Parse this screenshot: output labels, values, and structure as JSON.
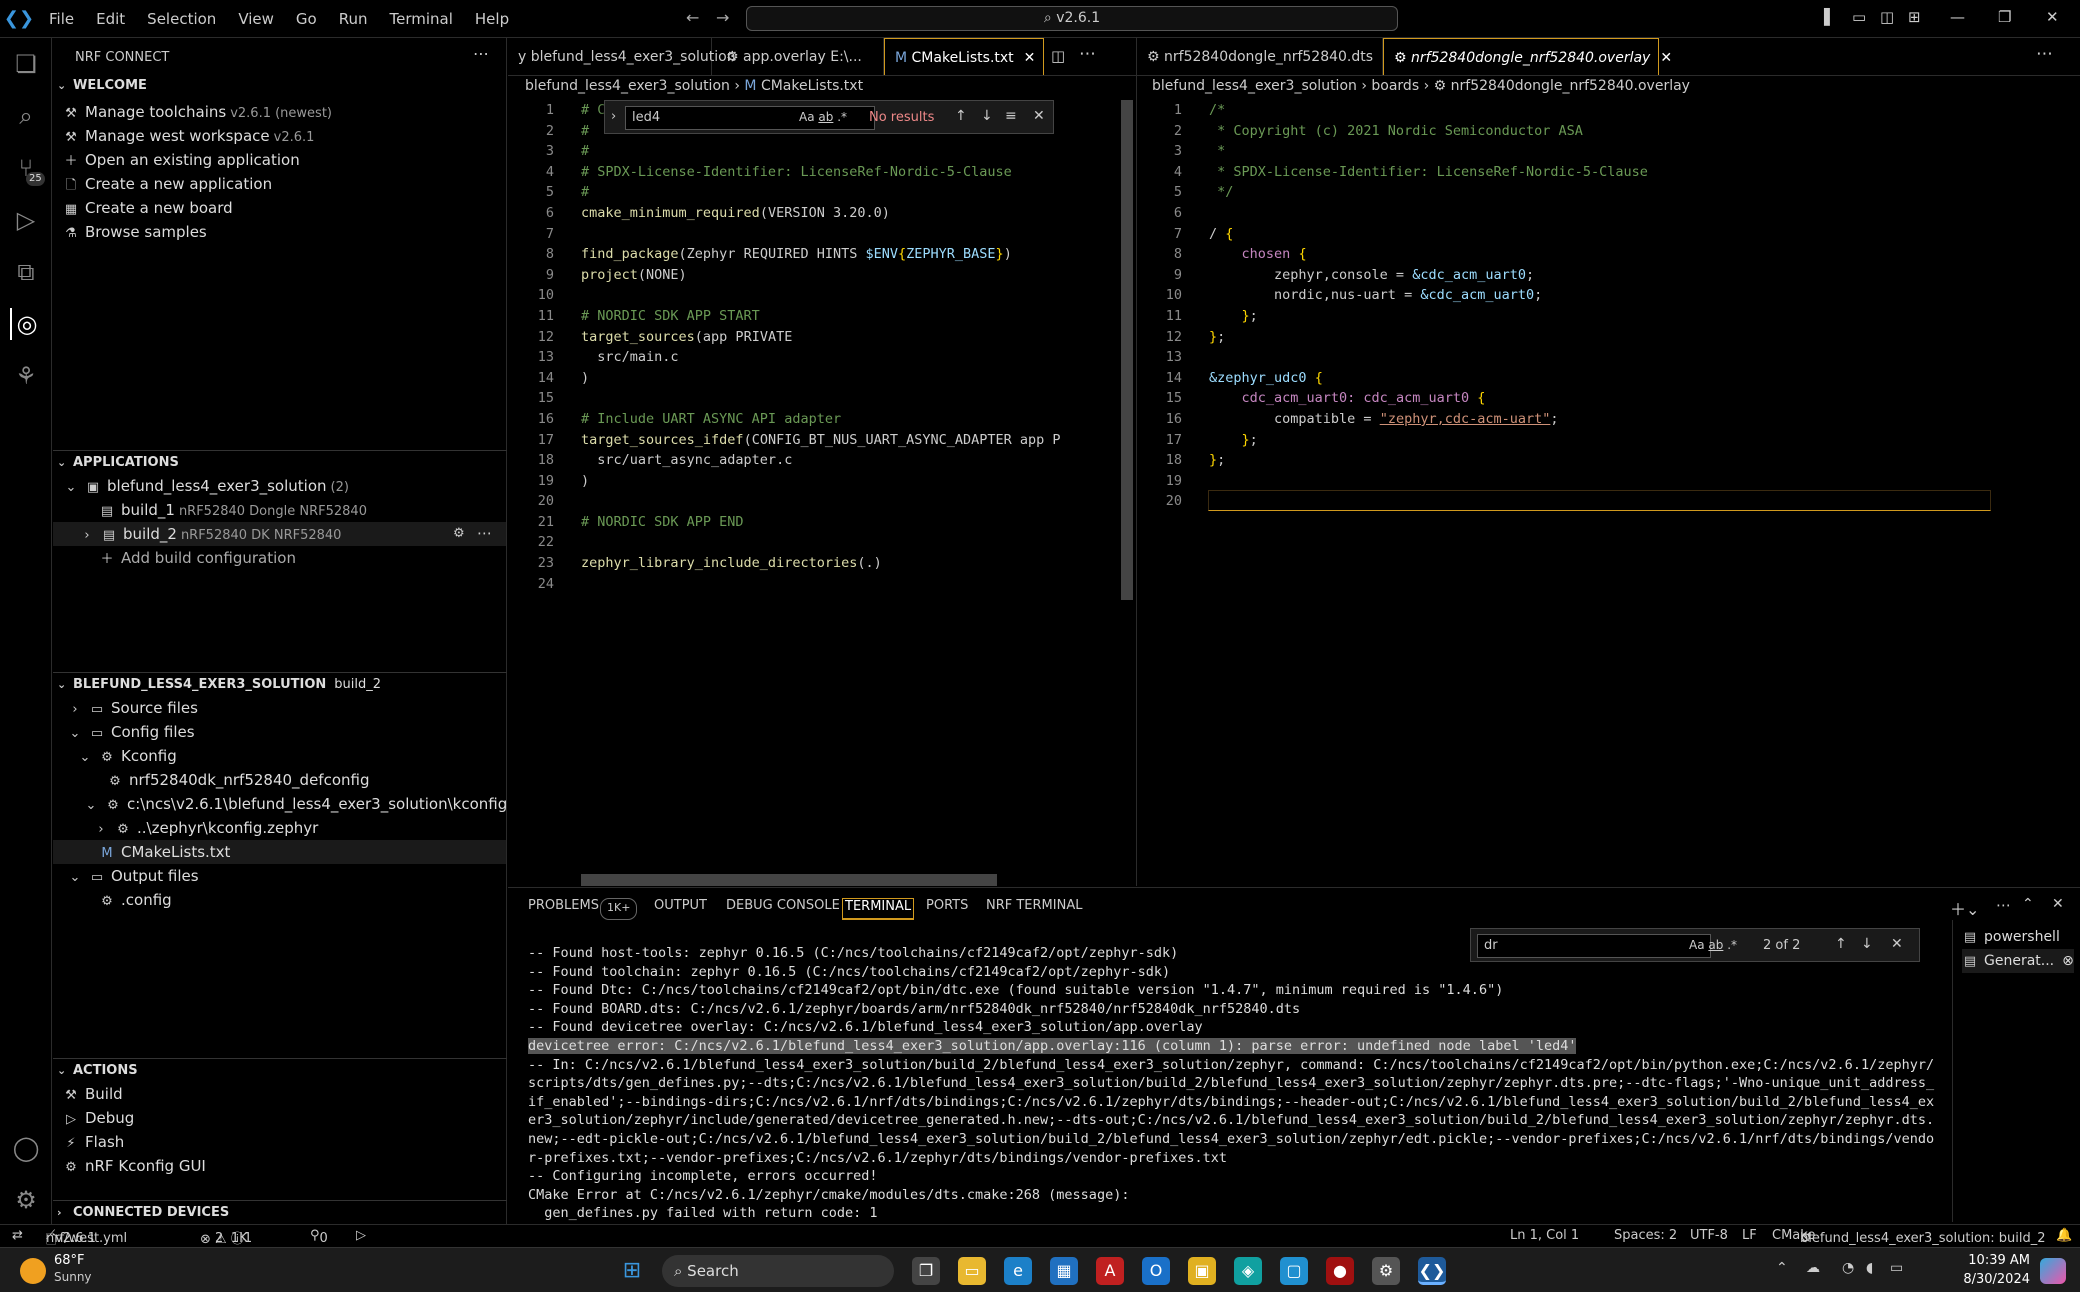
{
  "menu": [
    "File",
    "Edit",
    "Selection",
    "View",
    "Go",
    "Run",
    "Terminal",
    "Help"
  ],
  "command_center": "v2.6.1",
  "sidebar": {
    "title": "NRF CONNECT",
    "welcome": {
      "header": "WELCOME",
      "items": [
        {
          "label": "Manage toolchains",
          "detail": "v2.6.1 (newest)"
        },
        {
          "label": "Manage west workspace",
          "detail": "v2.6.1"
        },
        {
          "label": "Open an existing application",
          "detail": ""
        },
        {
          "label": "Create a new application",
          "detail": ""
        },
        {
          "label": "Create a new board",
          "detail": ""
        },
        {
          "label": "Browse samples",
          "detail": ""
        }
      ]
    },
    "applications": {
      "header": "APPLICATIONS",
      "app": "blefund_less4_exer3_solution",
      "app_count": "(2)",
      "builds": [
        {
          "label": "build_1",
          "detail": "nRF52840 Dongle NRF52840"
        },
        {
          "label": "build_2",
          "detail": "nRF52840 DK NRF52840"
        }
      ],
      "add": "Add build configuration"
    },
    "project": {
      "header": "BLEFUND_LESS4_EXER3_SOLUTION",
      "detail": "build_2",
      "items": [
        "Source files",
        "Config files",
        "Kconfig",
        "nrf52840dk_nrf52840_defconfig",
        "c:\\ncs\\v2.6.1\\blefund_less4_exer3_solution\\kconfig",
        "..\\zephyr\\kconfig.zephyr",
        "CMakeLists.txt",
        "Output files",
        ".config"
      ]
    },
    "actions": {
      "header": "ACTIONS",
      "items": [
        "Build",
        "Debug",
        "Flash",
        "nRF Kconfig GUI"
      ]
    },
    "connected": "CONNECTED DEVICES"
  },
  "left_editor": {
    "tabs": [
      "y  blefund_less4_exer3_solution",
      "app.overlay  E:\\...",
      "CMakeLists.txt"
    ],
    "breadcrumb": [
      "blefund_less4_exer3_solution",
      "CMakeLists.txt"
    ],
    "find": {
      "query": "led4",
      "result": "No results"
    },
    "lines": [
      "# Copyright (c) ...",
      "#",
      "#",
      "# SPDX-License-Identifier: LicenseRef-Nordic-5-Clause",
      "#",
      "cmake_minimum_required(VERSION 3.20.0)",
      "",
      "find_package(Zephyr REQUIRED HINTS $ENV{ZEPHYR_BASE})",
      "project(NONE)",
      "",
      "# NORDIC SDK APP START",
      "target_sources(app PRIVATE",
      "  src/main.c",
      ")",
      "",
      "# Include UART ASYNC API adapter",
      "target_sources_ifdef(CONFIG_BT_NUS_UART_ASYNC_ADAPTER app P",
      "  src/uart_async_adapter.c",
      ")",
      "",
      "# NORDIC SDK APP END",
      "",
      "zephyr_library_include_directories(.)",
      ""
    ]
  },
  "right_editor": {
    "tabs": [
      "nrf52840dongle_nrf52840.dts",
      "nrf52840dongle_nrf52840.overlay"
    ],
    "breadcrumb": [
      "blefund_less4_exer3_solution",
      "boards",
      "nrf52840dongle_nrf52840.overlay"
    ],
    "lines": [
      "/*",
      " * Copyright (c) 2021 Nordic Semiconductor ASA",
      " *",
      " * SPDX-License-Identifier: LicenseRef-Nordic-5-Clause",
      " */",
      "",
      "/ {",
      "    chosen {",
      "        zephyr,console = &cdc_acm_uart0;",
      "        nordic,nus-uart = &cdc_acm_uart0;",
      "    };",
      "};",
      "",
      "&zephyr_udc0 {",
      "    cdc_acm_uart0: cdc_acm_uart0 {",
      "        compatible = \"zephyr,cdc-acm-uart\";",
      "    };",
      "};",
      "",
      ""
    ]
  },
  "panel": {
    "tabs": [
      "PROBLEMS",
      "1K+",
      "OUTPUT",
      "DEBUG CONSOLE",
      "TERMINAL",
      "PORTS",
      "NRF TERMINAL"
    ],
    "find": {
      "query": "dr",
      "result": "2 of 2"
    },
    "terminals": [
      "powershell",
      "Generat..."
    ],
    "lines": [
      "-- Found host-tools: zephyr 0.16.5 (C:/ncs/toolchains/cf2149caf2/opt/zephyr-sdk)",
      "-- Found toolchain: zephyr 0.16.5 (C:/ncs/toolchains/cf2149caf2/opt/zephyr-sdk)",
      "-- Found Dtc: C:/ncs/toolchains/cf2149caf2/opt/bin/dtc.exe (found suitable version \"1.4.7\", minimum required is \"1.4.6\")",
      "-- Found BOARD.dts: C:/ncs/v2.6.1/zephyr/boards/arm/nrf52840dk_nrf52840/nrf52840dk_nrf52840.dts",
      "-- Found devicetree overlay: C:/ncs/v2.6.1/blefund_less4_exer3_solution/app.overlay",
      "devicetree error: C:/ncs/v2.6.1/blefund_less4_exer3_solution/app.overlay:116 (column 1): parse error: undefined node label 'led4'",
      "-- In: C:/ncs/v2.6.1/blefund_less4_exer3_solution/build_2/blefund_less4_exer3_solution/zephyr, command: C:/ncs/toolchains/cf2149caf2/opt/bin/python.exe;C:/ncs/v2.6.1/zephyr/scripts/dts/gen_defines.py;--dts;C:/ncs/v2.6.1/blefund_less4_exer3_solution/build_2/blefund_less4_exer3_solution/zephyr/zephyr.dts.pre;--dtc-flags;'-Wno-unique_unit_address_if_enabled';--bindings-dirs;C:/ncs/v2.6.1/nrf/dts/bindings;C:/ncs/v2.6.1/zephyr/dts/bindings;--header-out;C:/ncs/v2.6.1/blefund_less4_exer3_solution/build_2/blefund_less4_exer3_solution/zephyr/include/generated/devicetree_generated.h.new;--dts-out;C:/ncs/v2.6.1/blefund_less4_exer3_solution/build_2/blefund_less4_exer3_solution/zephyr/zephyr.dts.new;--edt-pickle-out;C:/ncs/v2.6.1/blefund_less4_exer3_solution/build_2/blefund_less4_exer3_solution/zephyr/edt.pickle;--vendor-prefixes;C:/ncs/v2.6.1/nrf/dts/bindings/vendor-prefixes.txt;--vendor-prefixes;C:/ncs/v2.6.1/zephyr/dts/bindings/vendor-prefixes.txt",
      "-- Configuring incomplete, errors occurred!",
      "CMake Error at C:/ncs/v2.6.1/zephyr/cmake/modules/dts.cmake:268 (message):",
      "  gen_defines.py failed with return code: 1"
    ]
  },
  "status": {
    "west": "nrf/west.yml",
    "version": "v2.6.1",
    "errors": "2",
    "warnings": "1K",
    "info": "1",
    "ports": "0",
    "position": "Ln 1, Col 1",
    "spaces": "Spaces: 2",
    "encoding": "UTF-8",
    "eol": "LF",
    "language": "CMake",
    "context": "blefund_less4_exer3_solution: build_2"
  },
  "taskbar": {
    "temp": "68°F",
    "weather": "Sunny",
    "search": "Search",
    "time": "10:39 AM",
    "date": "8/30/2024"
  },
  "colors": {
    "accent": "#d19a1e",
    "brand": "#3a96dd"
  }
}
